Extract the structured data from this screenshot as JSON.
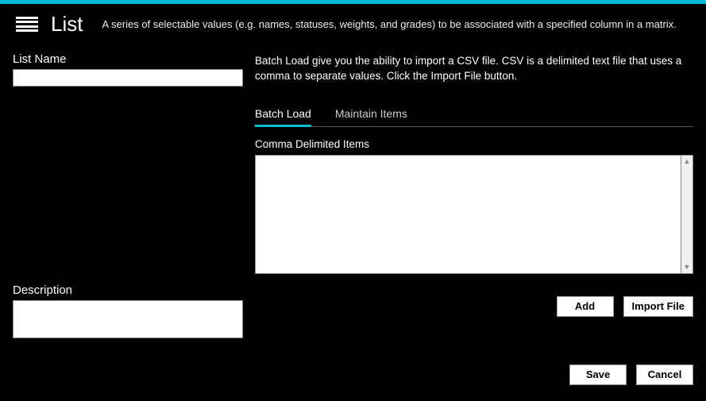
{
  "header": {
    "title": "List",
    "subtitle": "A series of selectable values (e.g. names, statuses, weights, and grades) to be associated with a specified column in a matrix."
  },
  "left": {
    "listNameLabel": "List Name",
    "listNameValue": "",
    "descriptionLabel": "Description",
    "descriptionValue": ""
  },
  "right": {
    "instructions": "Batch Load give you the ability to import a CSV file. CSV is a delimited text file that uses a comma to separate values. Click the Import File button.",
    "tabs": {
      "batchLoad": "Batch Load",
      "maintainItems": "Maintain Items"
    },
    "commaLabel": "Comma Delimited Items",
    "commaValue": ""
  },
  "buttons": {
    "add": "Add",
    "importFile": "Import File",
    "save": "Save",
    "cancel": "Cancel"
  }
}
